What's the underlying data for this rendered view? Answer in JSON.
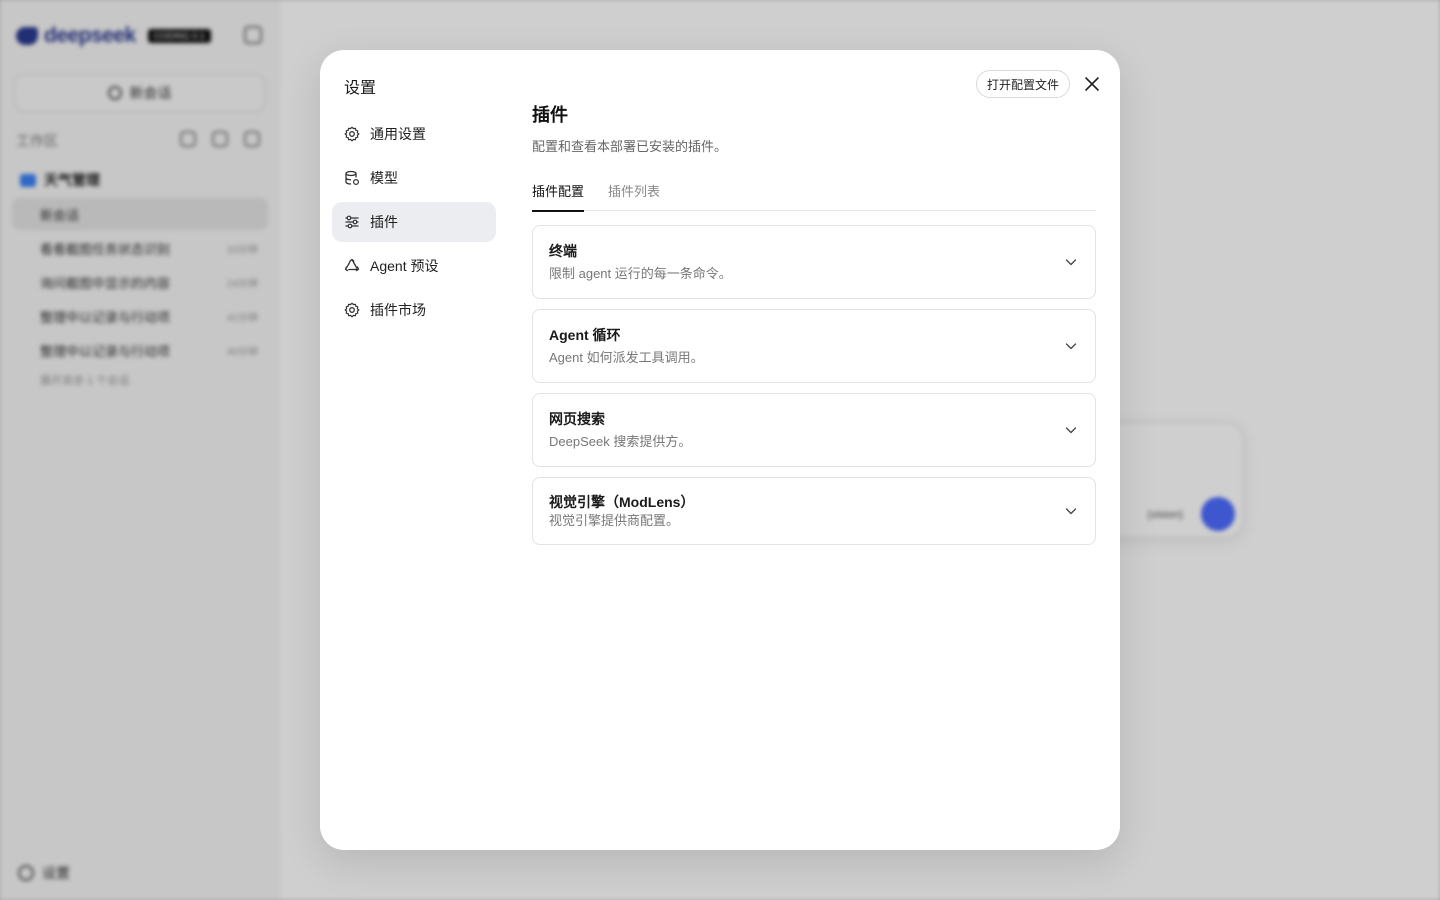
{
  "background": {
    "logo_text": "deepseek",
    "logo_badge": "CODING 0.1",
    "new_chat": "新会话",
    "workspace_label": "工作区",
    "folder_name": "天气管理",
    "conversations": [
      {
        "title": "新会话",
        "time": ""
      },
      {
        "title": "看看截图任务状态识别",
        "time": "10分钟"
      },
      {
        "title": "询问截图中显示的内容",
        "time": "24分钟"
      },
      {
        "title": "整理中以记录与行动项",
        "time": "41分钟"
      },
      {
        "title": "整理中以记录与行动项",
        "time": "40分钟"
      }
    ],
    "expand_more": "展开其余 1 个会话",
    "settings": "设置",
    "model_selector": "(vision)"
  },
  "modal": {
    "title": "设置",
    "open_config_button": "打开配置文件",
    "nav": [
      {
        "label": "通用设置",
        "icon": "gear-icon"
      },
      {
        "label": "模型",
        "icon": "database-icon"
      },
      {
        "label": "插件",
        "icon": "sliders-icon",
        "active": true
      },
      {
        "label": "Agent 预设",
        "icon": "recycle-icon"
      },
      {
        "label": "插件市场",
        "icon": "gear-icon"
      }
    ],
    "content": {
      "title": "插件",
      "description": "配置和查看本部署已安装的插件。",
      "tabs": [
        {
          "label": "插件配置",
          "active": true
        },
        {
          "label": "插件列表",
          "active": false
        }
      ],
      "plugins": [
        {
          "name": "终端",
          "description": "限制 agent 运行的每一条命令。"
        },
        {
          "name": "Agent 循环",
          "description": "Agent 如何派发工具调用。"
        },
        {
          "name": "网页搜索",
          "description": "DeepSeek 搜索提供方。"
        },
        {
          "name": "视觉引擎（ModLens）",
          "description": "视觉引擎提供商配置。"
        }
      ]
    }
  },
  "colors": {
    "accent": "#4d6bfe",
    "overlay": "rgba(0,0,0,0.19)",
    "active_nav_bg": "#ebedf0"
  }
}
